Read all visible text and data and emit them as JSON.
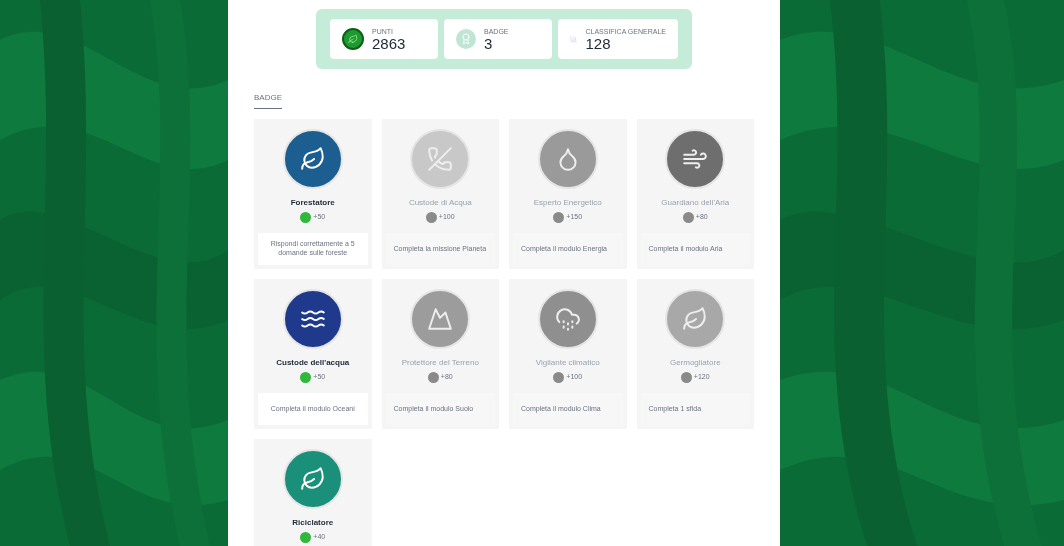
{
  "stats": [
    {
      "kind": "points",
      "label": "PUNTI",
      "value": "2863"
    },
    {
      "kind": "badges",
      "label": "BADGE",
      "value": "3"
    },
    {
      "kind": "rank",
      "label": "CLASSIFICA GENERALE",
      "value": "128"
    }
  ],
  "section": {
    "title": "BADGE"
  },
  "badges": [
    {
      "title": "Forestatore",
      "points": "+50",
      "description": "Rispondi correttamente a 5 domande sulle foreste",
      "unlocked": true,
      "kind": "leaf",
      "color": "#1b5e8f"
    },
    {
      "title": "Custode di Acqua",
      "points": "+100",
      "description": "Completa la missione Pianeta",
      "unlocked": false,
      "kind": "phone",
      "color": "#c8c8c8"
    },
    {
      "title": "Esperto Energetico",
      "points": "+150",
      "description": "Completa il modulo Energia",
      "unlocked": false,
      "kind": "drop",
      "color": "#9a9a9a"
    },
    {
      "title": "Guardiano dell'Aria",
      "points": "+80",
      "description": "Completa il modulo Aria",
      "unlocked": false,
      "kind": "wind",
      "color": "#6e6e6e"
    },
    {
      "title": "Custode dell'acqua",
      "points": "+50",
      "description": "Completa il modulo Oceani",
      "unlocked": true,
      "kind": "waves",
      "color": "#1f3a8c"
    },
    {
      "title": "Protettore del Terreno",
      "points": "+80",
      "description": "Completa il modulo Suolo",
      "unlocked": false,
      "kind": "mountain",
      "color": "#9c9c9c"
    },
    {
      "title": "Vigilante climatico",
      "points": "+100",
      "description": "Completa il modulo Clima",
      "unlocked": false,
      "kind": "cloud",
      "color": "#8f8f8f"
    },
    {
      "title": "Germogliatore",
      "points": "+120",
      "description": "Completa 1 sfida",
      "unlocked": false,
      "kind": "leaf",
      "color": "#a8a8a8"
    },
    {
      "title": "Riciclatore",
      "points": "+40",
      "unlocked": true,
      "kind": "leaf",
      "color": "#1a8f7a"
    }
  ]
}
